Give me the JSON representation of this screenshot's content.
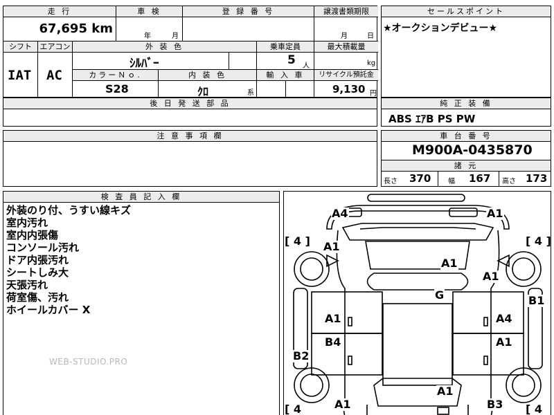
{
  "sheet": {
    "mileage": {
      "header": "走 行",
      "value": "67,695",
      "unit": "km"
    },
    "inspection": {
      "header": "車 検",
      "year_label": "年",
      "month_label": "月"
    },
    "registration": {
      "header": "登 録 番 号"
    },
    "transfer": {
      "header": "譲渡書類期限",
      "month_label": "月",
      "day_label": "日"
    },
    "shift": {
      "header": "シフト",
      "value": "IAT"
    },
    "aircon": {
      "header": "エアコン",
      "value": "AC"
    },
    "exterior_color": {
      "header": "外 装 色",
      "value": "ｼﾙﾊﾞｰ"
    },
    "capacity": {
      "header": "乗車定員",
      "value": "5",
      "unit": "人"
    },
    "max_load": {
      "header": "最大積載量",
      "unit": "kg"
    },
    "color_no": {
      "header": "カラーＮｏ.",
      "value": "S28"
    },
    "interior_color": {
      "header": "内 装 色",
      "value": "ｸﾛ",
      "suffix": "系"
    },
    "import_car": {
      "header": "輸 入 車"
    },
    "recycle": {
      "header": "リサイクル預託金",
      "value": "9,130",
      "unit": "円"
    },
    "later_parts": {
      "header": "後 日 発 送 部 品"
    },
    "notes": {
      "header": "注 意 事 項 欄"
    },
    "inspector": {
      "header": "検 査 員 記 入 欄",
      "lines": [
        "外装のり付、うすい線キズ",
        "室内汚れ",
        "室内内張傷",
        "コンソール汚れ",
        "ドア内張汚れ",
        "シートしみ大",
        "天張汚れ",
        "荷室傷、汚れ",
        "ホイールカバー X"
      ]
    },
    "sales_point": {
      "header": "セールスポイント",
      "value": "★オークションデビュー★"
    },
    "equipment": {
      "header": "純 正 装 備",
      "value": "ABS ｴｱB PS PW"
    },
    "chassis": {
      "header": "車 台 番 号",
      "value": "M900A-0435870"
    },
    "specs": {
      "header": "諸 元",
      "length_label": "長さ",
      "length": "370",
      "width_label": "幅",
      "width": "167",
      "height_label": "高さ",
      "height": "173"
    }
  },
  "diagram": {
    "tires": [
      "[ 4 ]",
      "[ 4 ]",
      "[ 4",
      "[ 4"
    ],
    "grades": [
      "A4",
      "A1",
      "A1",
      "A1",
      "A1",
      "G",
      "B1",
      "A1",
      "A4",
      "B4",
      "A1",
      "B2",
      "A1",
      "A1",
      "B3"
    ]
  },
  "watermark": "WEB-STUDIO.PRO"
}
